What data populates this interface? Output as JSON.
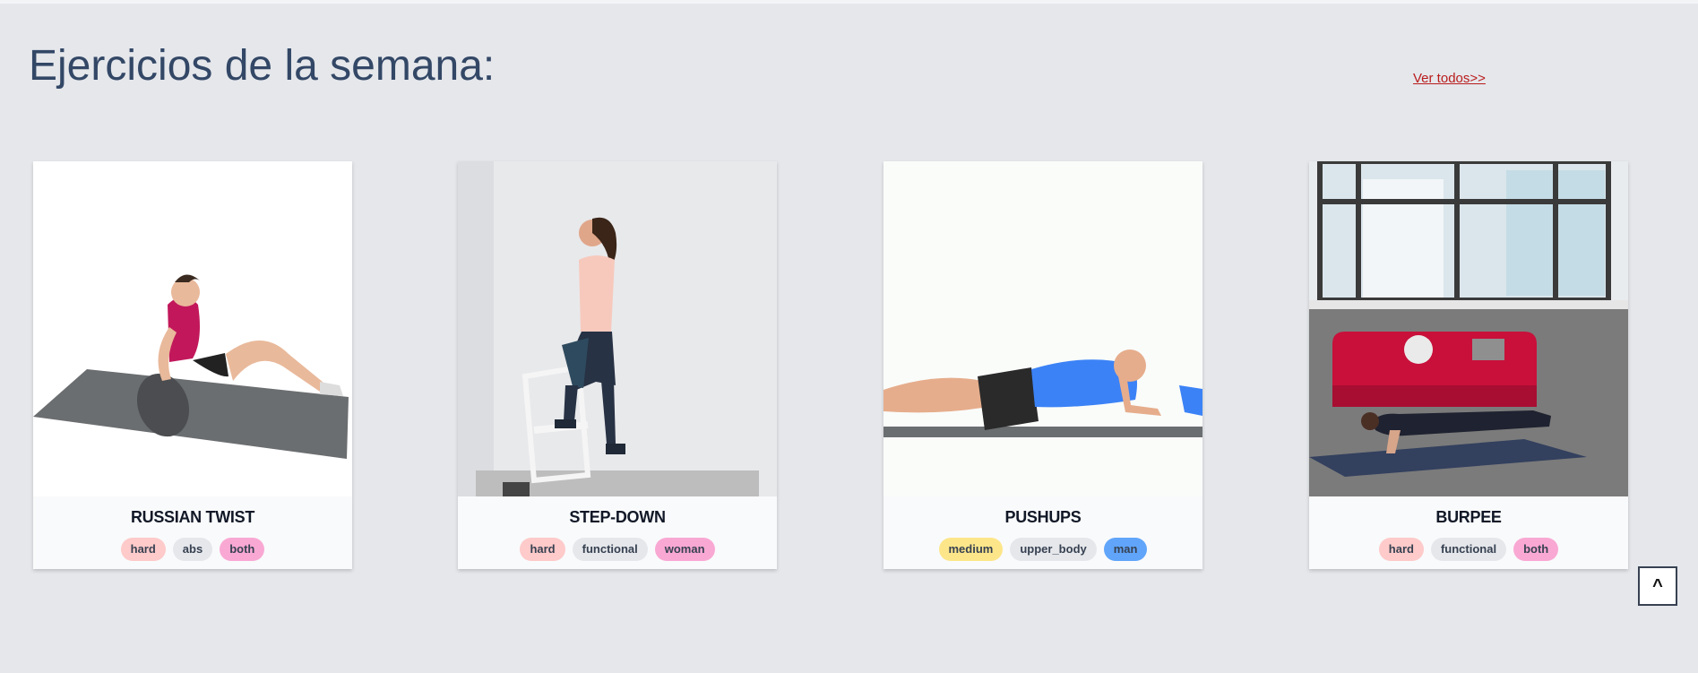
{
  "header": {
    "title": "Ejercicios de la semana:",
    "view_all": "Ver todos>>"
  },
  "exercises": [
    {
      "name": "RUSSIAN TWIST",
      "tags": [
        "hard",
        "abs",
        "both"
      ],
      "image": "russian-twist-animation"
    },
    {
      "name": "STEP-DOWN",
      "tags": [
        "hard",
        "functional",
        "woman"
      ],
      "image": "step-down-animation"
    },
    {
      "name": "PUSHUPS",
      "tags": [
        "medium",
        "upper_body",
        "man"
      ],
      "image": "pushups-animation"
    },
    {
      "name": "BURPEE",
      "tags": [
        "hard",
        "functional",
        "both"
      ],
      "image": "burpee-animation"
    }
  ],
  "scroll_top": {
    "label": "^"
  },
  "colors": {
    "background": "#e5e7eb",
    "title": "#334766",
    "link": "#b91c1c",
    "tag_hard": "#fecaca",
    "tag_medium": "#fde68a",
    "tag_category": "#e5e7eb",
    "tag_both": "#f9a8d4",
    "tag_man": "#60a5fa"
  }
}
